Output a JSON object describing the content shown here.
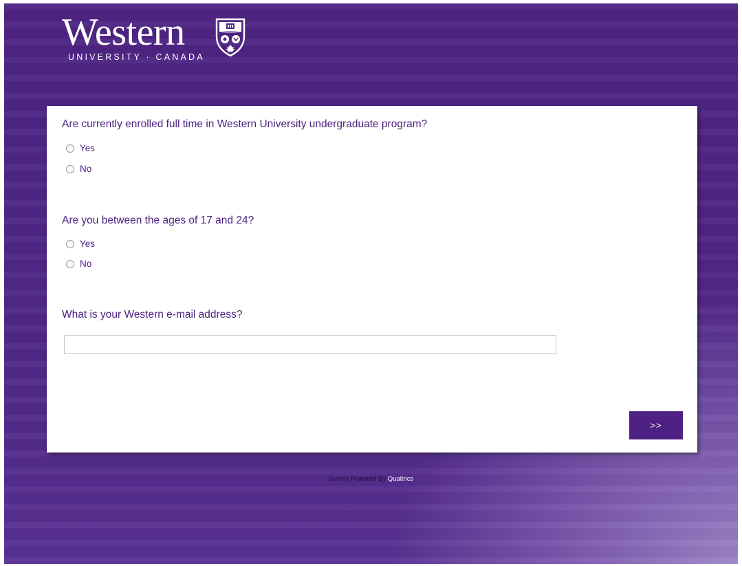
{
  "branding": {
    "wordmark": "Western",
    "subtitle": "UNIVERSITY · CANADA",
    "shield_icon": "western-crest-icon"
  },
  "questions": [
    {
      "text": "Are currently enrolled full time in Western University undergraduate program?",
      "choices": [
        "Yes",
        "No"
      ]
    },
    {
      "text": "Are you between the ages of 17 and 24?",
      "choices": [
        "Yes",
        "No"
      ]
    },
    {
      "text": "What is your Western e-mail address?",
      "input_value": "",
      "input_placeholder": ""
    }
  ],
  "navigation": {
    "next_label": ">>"
  },
  "footer": {
    "prefix": "Survey Powered By ",
    "link": "Qualtrics"
  },
  "colors": {
    "brand_purple": "#4f2184",
    "question_text": "#4b1f80"
  }
}
